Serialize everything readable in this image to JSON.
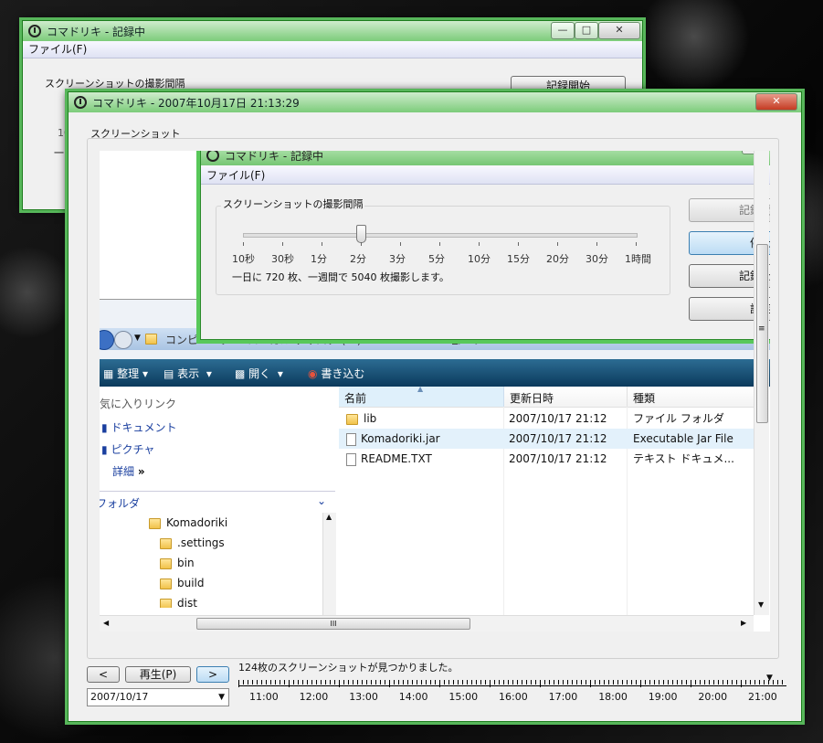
{
  "back_window": {
    "title": "コマドリキ - 記録中",
    "menu_file": "ファイル(F)",
    "group_label": "スクリーンショットの撮影間隔",
    "btn_record": "記録開始",
    "partial_value": "10",
    "partial_text": "一日"
  },
  "main_window": {
    "title": "コマドリキ - 2007年10月17日 21:13:29",
    "screenshot_label": "スクリーンショット",
    "prev_label": "<",
    "play_label": "再生(P)",
    "next_label": ">",
    "date_value": "2007/10/17",
    "status_text": "124枚のスクリーンショットが見つかりました。",
    "timeline_hours": [
      "11:00",
      "12:00",
      "13:00",
      "14:00",
      "15:00",
      "16:00",
      "17:00",
      "18:00",
      "19:00",
      "20:00",
      "21:00"
    ]
  },
  "inner_window": {
    "title": "コマドリキ - 記録中",
    "menu_file": "ファイル(F)",
    "group_label": "スクリーンショットの撮影間隔",
    "slider_ticks": [
      "10秒",
      "30秒",
      "1分",
      "2分",
      "3分",
      "5分",
      "10分",
      "15分",
      "20分",
      "30分",
      "1時間"
    ],
    "slider_index": 3,
    "info_text": "一日に 720 枚、一週間で 5040 枚撮影します。",
    "btn_record": "記録開",
    "btn_stop": "停止",
    "btn_record_as": "記録を",
    "btn_settings": "設定"
  },
  "explorer": {
    "breadcrumb": [
      "コンピュータ",
      "ローカル ディスク (C:)",
      "1",
      "netbeans_projects",
      "Komadoriki",
      "dist"
    ],
    "toolbar": {
      "organize": "整理",
      "view": "表示",
      "open": "開く",
      "burn": "書き込む"
    },
    "favorites_header": "お気に入りリンク",
    "favorites": [
      "ドキュメント",
      "ピクチャ"
    ],
    "more": "詳細",
    "folders_header": "フォルダ",
    "tree": [
      "Komadoriki",
      ".settings",
      "bin",
      "build",
      "dist"
    ],
    "columns": [
      "名前",
      "更新日時",
      "種類"
    ],
    "files": [
      {
        "name": "lib",
        "date": "2007/10/17 21:12",
        "type": "ファイル フォルダ",
        "kind": "folder"
      },
      {
        "name": "Komadoriki.jar",
        "date": "2007/10/17 21:12",
        "type": "Executable Jar File",
        "kind": "file"
      },
      {
        "name": "README.TXT",
        "date": "2007/10/17 21:12",
        "type": "テキスト ドキュメ...",
        "kind": "file"
      }
    ],
    "hscroll_grip": "III"
  }
}
